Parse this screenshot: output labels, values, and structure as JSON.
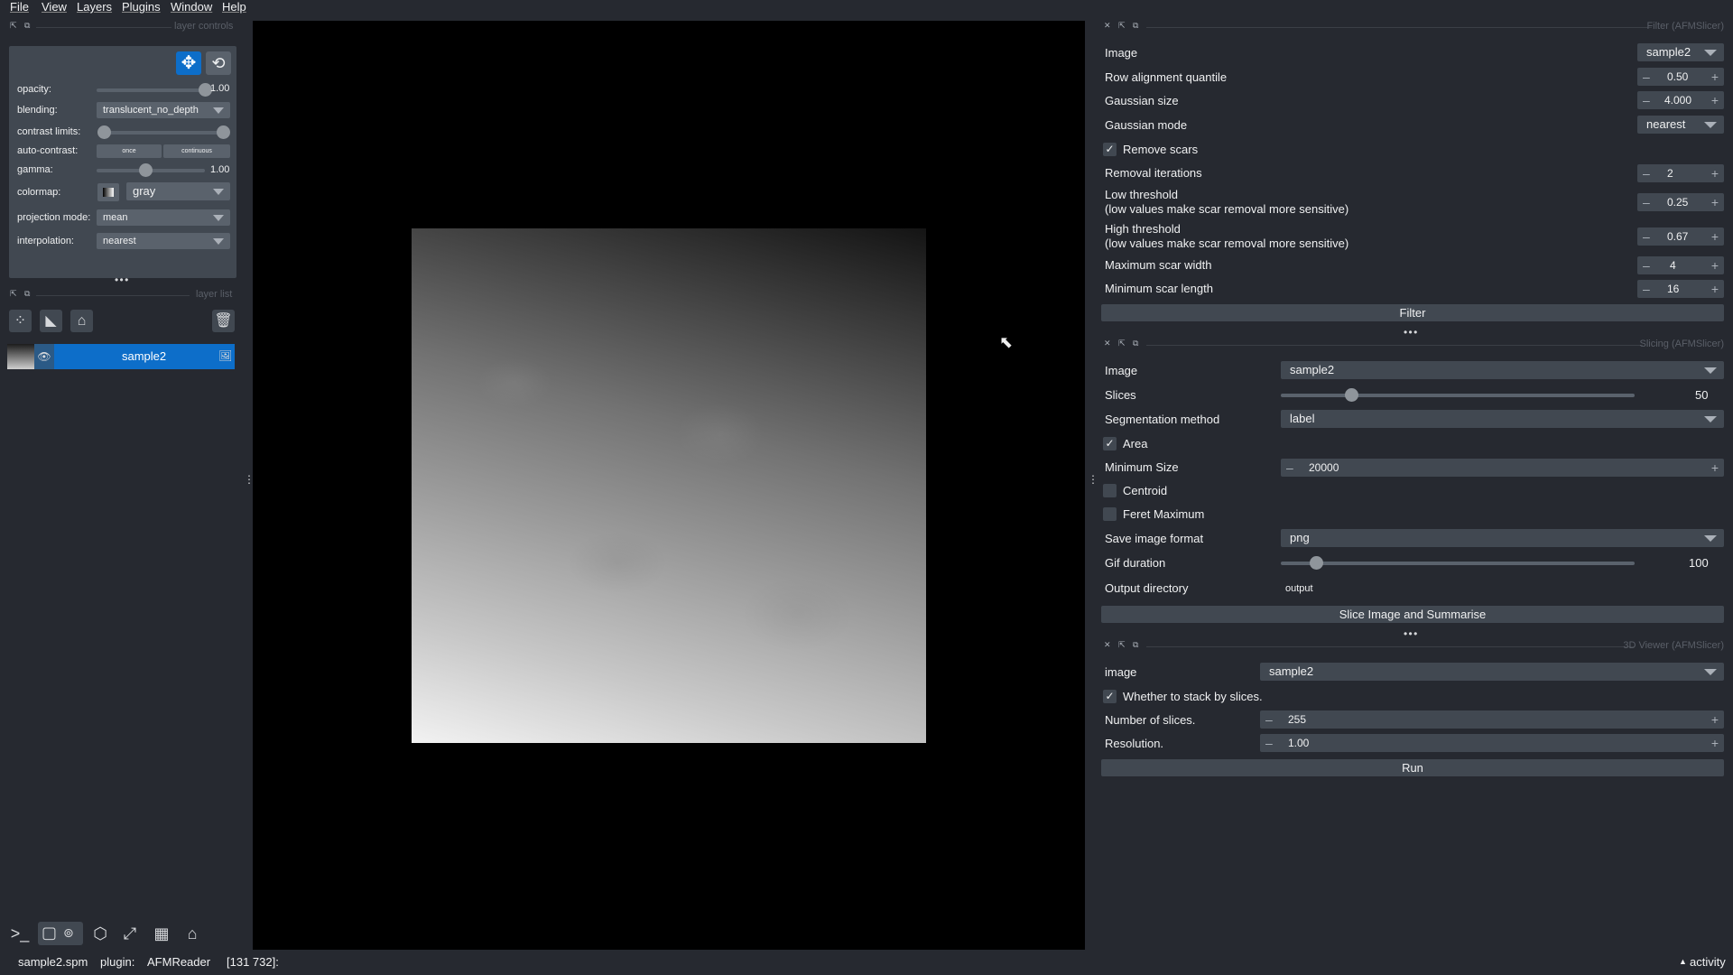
{
  "menu": [
    "File",
    "View",
    "Layers",
    "Plugins",
    "Window",
    "Help"
  ],
  "layer_controls": {
    "title": "layer controls",
    "opacity_label": "opacity:",
    "opacity_value": "1.00",
    "opacity_level": 1.0,
    "blending_label": "blending:",
    "blending_value": "translucent_no_depth",
    "contrast_label": "contrast limits:",
    "autocontrast_label": "auto-contrast:",
    "once_label": "once",
    "continuous_label": "continuous",
    "gamma_label": "gamma:",
    "gamma_value": "1.00",
    "gamma_level": 0.45,
    "colormap_label": "colormap:",
    "colormap_value": "gray",
    "projection_label": "projection mode:",
    "projection_value": "mean",
    "interpolation_label": "interpolation:",
    "interpolation_value": "nearest"
  },
  "layer_list": {
    "title": "layer list",
    "layers": [
      {
        "name": "sample2",
        "visible": true,
        "selected": true
      }
    ]
  },
  "filter_panel": {
    "title": "Filter (AFMSlicer)",
    "image_label": "Image",
    "image_value": "sample2",
    "row_quantile_label": "Row alignment quantile",
    "row_quantile_value": "0.50",
    "gaussian_size_label": "Gaussian size",
    "gaussian_size_value": "4.000",
    "gaussian_mode_label": "Gaussian mode",
    "gaussian_mode_value": "nearest",
    "remove_scars_label": "Remove scars",
    "remove_scars_checked": true,
    "removal_iterations_label": "Removal iterations",
    "removal_iterations_value": "2",
    "low_threshold_label": "Low threshold",
    "low_threshold_sub": "(low values make scar removal more sensitive)",
    "low_threshold_value": "0.25",
    "high_threshold_label": "High threshold",
    "high_threshold_sub": "(low values make scar removal more sensitive)",
    "high_threshold_value": "0.67",
    "max_scar_width_label": "Maximum scar width",
    "max_scar_width_value": "4",
    "min_scar_length_label": "Minimum scar length",
    "min_scar_length_value": "16",
    "filter_button": "Filter"
  },
  "slicing_panel": {
    "title": "Slicing (AFMSlicer)",
    "image_label": "Image",
    "image_value": "sample2",
    "slices_label": "Slices",
    "slices_value": "50",
    "slices_level": 0.2,
    "segmentation_label": "Segmentation method",
    "segmentation_value": "label",
    "area_label": "Area",
    "area_checked": true,
    "min_size_label": "Minimum Size",
    "min_size_value": "20000",
    "centroid_label": "Centroid",
    "centroid_checked": false,
    "feret_label": "Feret Maximum",
    "feret_checked": false,
    "save_format_label": "Save image format",
    "save_format_value": "png",
    "gif_duration_label": "Gif duration",
    "gif_duration_value": "100",
    "gif_duration_level": 0.1,
    "output_dir_label": "Output directory",
    "output_dir_value": "output",
    "slice_button": "Slice Image and Summarise"
  },
  "viewer3d_panel": {
    "title": "3D Viewer (AFMSlicer)",
    "image_label": "image",
    "image_value": "sample2",
    "stack_label": "Whether to stack by slices.",
    "stack_checked": true,
    "num_slices_label": "Number of slices.",
    "num_slices_value": "255",
    "resolution_label": "Resolution.",
    "resolution_value": "1.00",
    "run_button": "Run"
  },
  "status_bar": {
    "file": "sample2.spm",
    "plugin_label": "plugin:",
    "plugin_value": "AFMReader",
    "coords": "[131 732]:",
    "activity": "activity"
  }
}
